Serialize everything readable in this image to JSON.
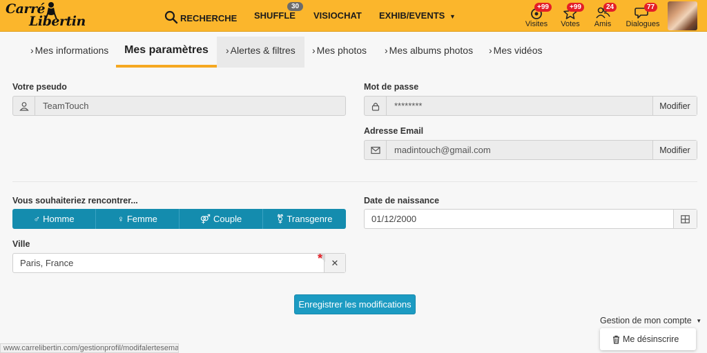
{
  "header": {
    "logo_line1": "Carré",
    "logo_line2": "Libertin",
    "nav": {
      "search": "RECHERCHE",
      "shuffle": "SHUFFLE",
      "shuffle_badge": "30",
      "visiochat": "VISIOCHAT",
      "exhib": "EXHIB/EVENTS"
    },
    "stats": [
      {
        "label": "Visites",
        "badge": "+99",
        "icon": "eye-icon"
      },
      {
        "label": "Votes",
        "badge": "+99",
        "icon": "star-icon"
      },
      {
        "label": "Amis",
        "badge": "24",
        "icon": "friends-icon"
      },
      {
        "label": "Dialogues",
        "badge": "77",
        "icon": "chat-icon"
      }
    ],
    "colors": {
      "bar": "#fbb62c",
      "badge": "#e41e26"
    }
  },
  "tabs": [
    "Mes informations",
    "Mes paramètres",
    "Alertes & filtres",
    "Mes photos",
    "Mes albums photos",
    "Mes vidéos"
  ],
  "form": {
    "pseudo_label": "Votre pseudo",
    "pseudo_value": "TeamTouch",
    "password_label": "Mot de passe",
    "password_value": "********",
    "email_label": "Adresse Email",
    "email_value": "madintouch@gmail.com",
    "modify": "Modifier",
    "meet_label": "Vous souhaiteriez rencontrer...",
    "meet_options": [
      "Homme",
      "Femme",
      "Couple",
      "Transgenre"
    ],
    "birth_label": "Date de naissance",
    "birth_value": "01/12/2000",
    "city_label": "Ville",
    "city_value": "Paris, France",
    "required_mark": "*",
    "clear": "✕",
    "save": "Enregistrer les modifications",
    "accent": "#1c9bc2"
  },
  "account": {
    "menu": "Gestion de mon compte",
    "unsubscribe": "Me désinscrire"
  },
  "statusbar": "www.carrelibertin.com/gestionprofil/modifalertesemail"
}
